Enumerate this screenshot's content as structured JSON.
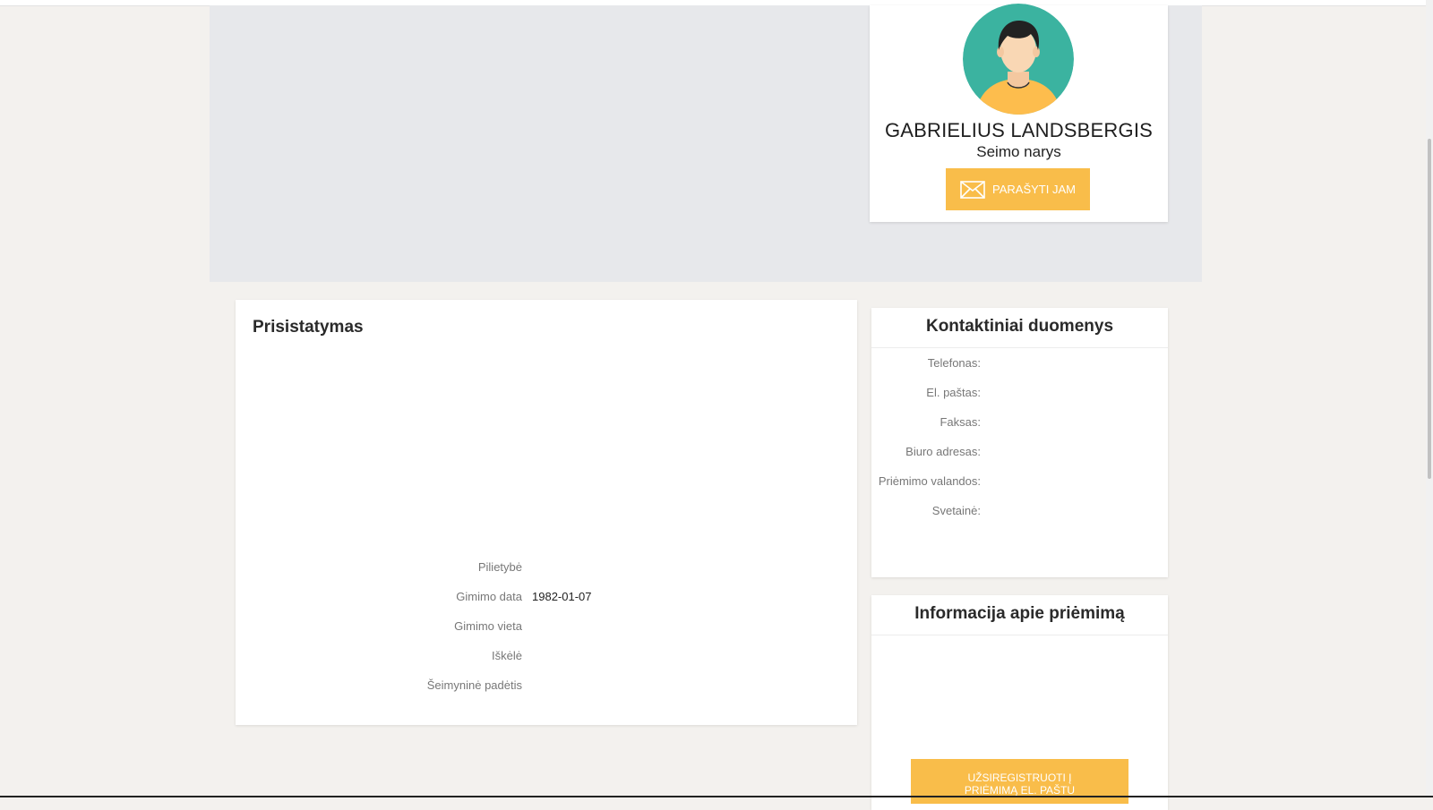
{
  "profile": {
    "name": "GABRIELIUS LANDSBERGIS",
    "role": "Seimo narys",
    "write_button": "PARAŠYTI JAM",
    "avatar_icon": "user-avatar-icon",
    "mail_icon": "envelope-icon"
  },
  "intro": {
    "title": "Prisistatymas",
    "facts": [
      {
        "label": "Pilietybė",
        "value": ""
      },
      {
        "label": "Gimimo data",
        "value": "1982-01-07"
      },
      {
        "label": "Gimimo vieta",
        "value": ""
      },
      {
        "label": "Iškėlė",
        "value": ""
      },
      {
        "label": "Šeimyninė padėtis",
        "value": ""
      }
    ]
  },
  "contact": {
    "title": "Kontaktiniai duomenys",
    "labels": [
      "Telefonas:",
      "El. paštas:",
      "Faksas:",
      "Biuro adresas:",
      "Priėmimo valandos:",
      "Svetainė:"
    ]
  },
  "reception": {
    "title": "Informacija apie priėmimą",
    "register_button_line1": "UŽSIREGISTRUOTI Į",
    "register_button_line2": "PRIĖMIMĄ EL. PAŠTU"
  },
  "colors": {
    "accent": "#f9bd4a",
    "avatar_bg": "#3bb3a0",
    "hero_bg": "#e7e8eb",
    "page_bg": "#f3f1ee"
  }
}
